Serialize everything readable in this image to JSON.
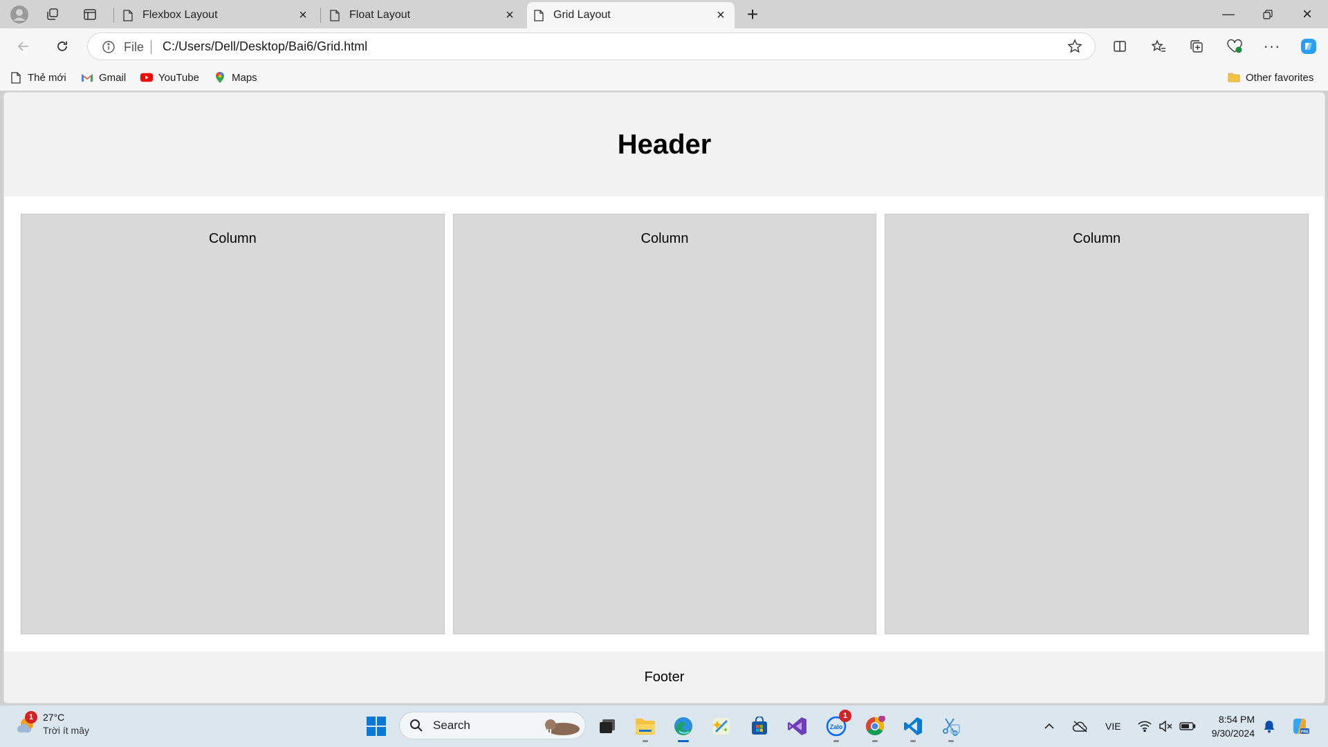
{
  "browser": {
    "tabs": [
      {
        "title": "Flexbox Layout",
        "active": false
      },
      {
        "title": "Float Layout",
        "active": false
      },
      {
        "title": "Grid Layout",
        "active": true
      }
    ],
    "address": {
      "scheme": "File",
      "url": "C:/Users/Dell/Desktop/Bai6/Grid.html"
    },
    "favorites": [
      {
        "label": "Thẻ mới",
        "icon": "page-icon"
      },
      {
        "label": "Gmail",
        "icon": "gmail-icon"
      },
      {
        "label": "YouTube",
        "icon": "youtube-icon"
      },
      {
        "label": "Maps",
        "icon": "maps-pin-icon"
      }
    ],
    "other_favorites": "Other favorites"
  },
  "page": {
    "header": "Header",
    "columns": [
      "Column",
      "Column",
      "Column"
    ],
    "footer": "Footer"
  },
  "taskbar": {
    "weather": {
      "temp": "27°C",
      "condition": "Trời ít mây",
      "badge": "1"
    },
    "search_placeholder": "Search",
    "zalo_badge": "1",
    "language": "VIE",
    "time": "8:54 PM",
    "date": "9/30/2024"
  },
  "colors": {
    "page_header_bg": "#f2f2f2",
    "column_bg": "#d9d9d9",
    "taskbar_bg": "#dbe6ee",
    "accent": "#0a64c8"
  }
}
